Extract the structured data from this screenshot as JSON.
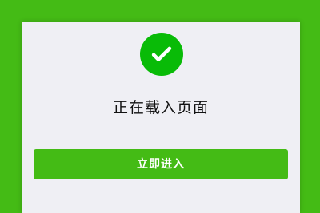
{
  "page": {
    "status_text": "正在载入页面",
    "enter_button_label": "立即进入"
  },
  "icons": {
    "status_icon": "check-circle-icon"
  },
  "colors": {
    "page_background": "#44bb15",
    "card_background": "#efeff4",
    "success_green": "#09bb07",
    "button_background": "#44bb15",
    "button_text": "#ffffff",
    "status_text": "#111111"
  }
}
